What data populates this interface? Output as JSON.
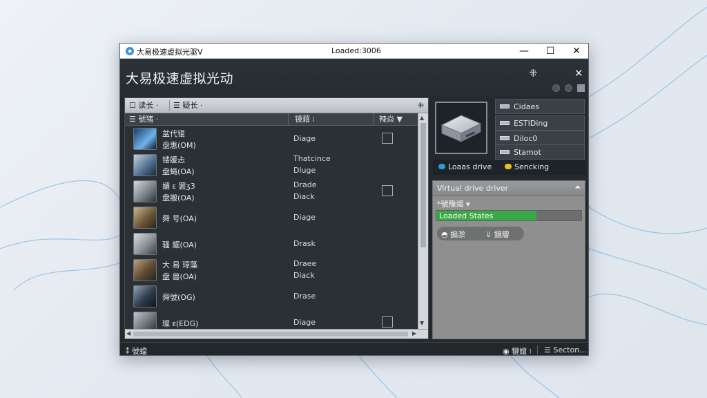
{
  "window": {
    "title": "大易极速虚拟光驱V",
    "center_title": "Loaded:3006",
    "minimize": "—",
    "maximize": "☐",
    "close": "✕"
  },
  "header": {
    "app_title": "大易极速虚拟光动",
    "pin_icon": "⁜",
    "close_icon": "✕"
  },
  "toolbar": {
    "items": [
      {
        "label": "☐ 读长 ·"
      },
      {
        "label": "☰ 疑长 ·"
      }
    ],
    "pin_label": "⁜"
  },
  "columns": {
    "name": "☰ 號猪 ·",
    "type": "镜藉 ⁝",
    "status": "辣焱 ▼"
  },
  "rows": [
    {
      "line1": "盆代锟",
      "line2": "盘惠(OM)",
      "type1": "",
      "type2": "Diage",
      "checked": false,
      "show_check": true
    },
    {
      "line1": "镂媛忐",
      "line2": "盘蝇(OA)",
      "type1": "Thatcince",
      "type2": "Dluge",
      "checked": false,
      "show_check": false
    },
    {
      "line1": "媚 ᴇ 罢ʒ3",
      "line2": "盘搬(OA)",
      "type1": "Drade",
      "type2": "Diack",
      "checked": false,
      "show_check": true
    },
    {
      "line1": "",
      "line2": "舜 号(OA)",
      "type1": "",
      "type2": "Diage",
      "checked": false,
      "show_check": false
    },
    {
      "line1": "",
      "line2": "骚 鋸(OA)",
      "type1": "",
      "type2": "Drask",
      "checked": false,
      "show_check": false
    },
    {
      "line1": "大 易 璋藻",
      "line2": "盘 兽(OA)",
      "type1": "Draee",
      "type2": "Diack",
      "checked": false,
      "show_check": false
    },
    {
      "line1": "",
      "line2": "舜號(OG)",
      "type1": "",
      "type2": "Drase",
      "checked": false,
      "show_check": false
    },
    {
      "line1": "",
      "line2": "璨 ᴇ(EDG)",
      "type1": "",
      "type2": "Diage",
      "checked": false,
      "show_check": true
    }
  ],
  "info": [
    {
      "label": "Cidaes"
    },
    {
      "label": "ESTIDing"
    },
    {
      "label": "Diloc0"
    },
    {
      "label": "Stamot"
    }
  ],
  "status_row": {
    "left": "Loaas drive",
    "right": "Sencking"
  },
  "vpanel": {
    "title": "Virtual drive driver",
    "collapse": "⏶",
    "sub": "*號豫竭 ▾",
    "progress_label": "Loaded States",
    "progress_value": 0.69,
    "btn1": "◓  搧淤",
    "btn2": "⇓ 鏡瓣"
  },
  "statusbar": {
    "left": "⁑ 號蟷",
    "mid": "◉ 犍嬗 ⁝",
    "right": "☰ Secton..."
  },
  "colors": {
    "progress_fill": "#3aa846",
    "status_pill_left": "#2f9ad8",
    "status_pill_right": "#e5c020"
  }
}
